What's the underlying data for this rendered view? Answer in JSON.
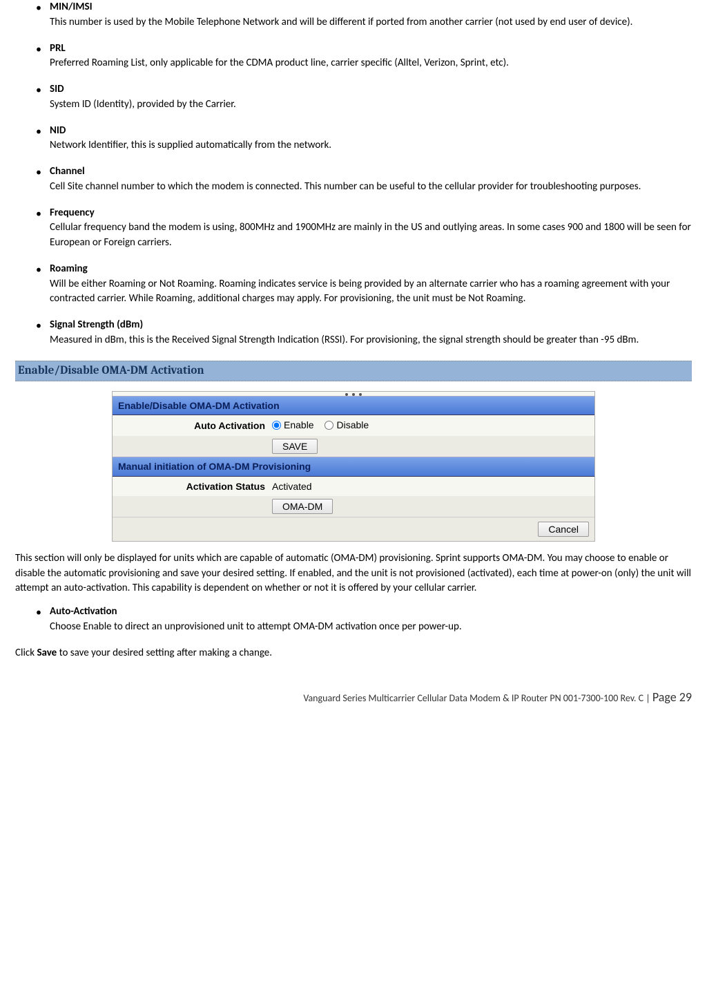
{
  "defs": [
    {
      "term": "MIN/IMSI",
      "desc": "This number is used by the Mobile Telephone Network and will be different if ported from another carrier (not used by end user of device)."
    },
    {
      "term": "PRL",
      "desc": "Preferred Roaming List, only applicable for the CDMA product line, carrier specific (Alltel, Verizon, Sprint, etc)."
    },
    {
      "term": "SID",
      "desc": "System ID (Identity), provided by the Carrier."
    },
    {
      "term": "NID",
      "desc": "Network Identifier, this is supplied automatically from the network."
    },
    {
      "term": "Channel",
      "desc": "Cell Site channel number to which the modem is connected. This number can be useful to the cellular provider for troubleshooting purposes."
    },
    {
      "term": "Frequency",
      "desc": "Cellular frequency band the modem is using, 800MHz and 1900MHz are mainly in the US and outlying areas. In some cases 900 and 1800 will be seen for European or Foreign carriers."
    },
    {
      "term": "Roaming",
      "desc": "Will be either Roaming or Not Roaming. Roaming indicates service is being provided by an alternate carrier who has a roaming agreement with your contracted carrier. While Roaming, additional charges may apply. For provisioning, the unit must be Not Roaming."
    },
    {
      "term": "Signal Strength (dBm)",
      "desc": "Measured in dBm, this is the Received Signal Strength Indication (RSSI). For provisioning, the signal strength should be greater than -95 dBm."
    }
  ],
  "section_heading": "Enable/Disable OMA-DM Activation",
  "panel": {
    "title1": "Enable/Disable OMA-DM Activation",
    "auto_label": "Auto Activation",
    "enable": "Enable",
    "disable": "Disable",
    "save": "SAVE",
    "title2": "Manual initiation of OMA-DM Provisioning",
    "status_label": "Activation Status",
    "status_value": "Activated",
    "omadm": "OMA-DM",
    "cancel": "Cancel"
  },
  "para1": "This section will only be displayed for units which are capable of automatic (OMA-DM) provisioning. Sprint supports OMA-DM. You may choose to enable or disable the automatic provisioning and save your desired setting. If enabled, and the unit is not provisioned (activated), each time at power-on (only) the unit will attempt an auto-activation. This capability is dependent on whether or not it is offered by your cellular carrier.",
  "defs2": [
    {
      "term": "Auto-Activation",
      "desc": "Choose Enable to direct an unprovisioned unit to attempt OMA-DM activation once per power-up."
    }
  ],
  "para2_pre": "Click ",
  "para2_bold": "Save",
  "para2_post": " to save your desired setting after making a change.",
  "footer": {
    "text": "Vanguard Series Multicarrier Cellular Data Modem & IP Router PN 001-7300-100 Rev. C",
    "sep": " | ",
    "page": "Page 29"
  }
}
